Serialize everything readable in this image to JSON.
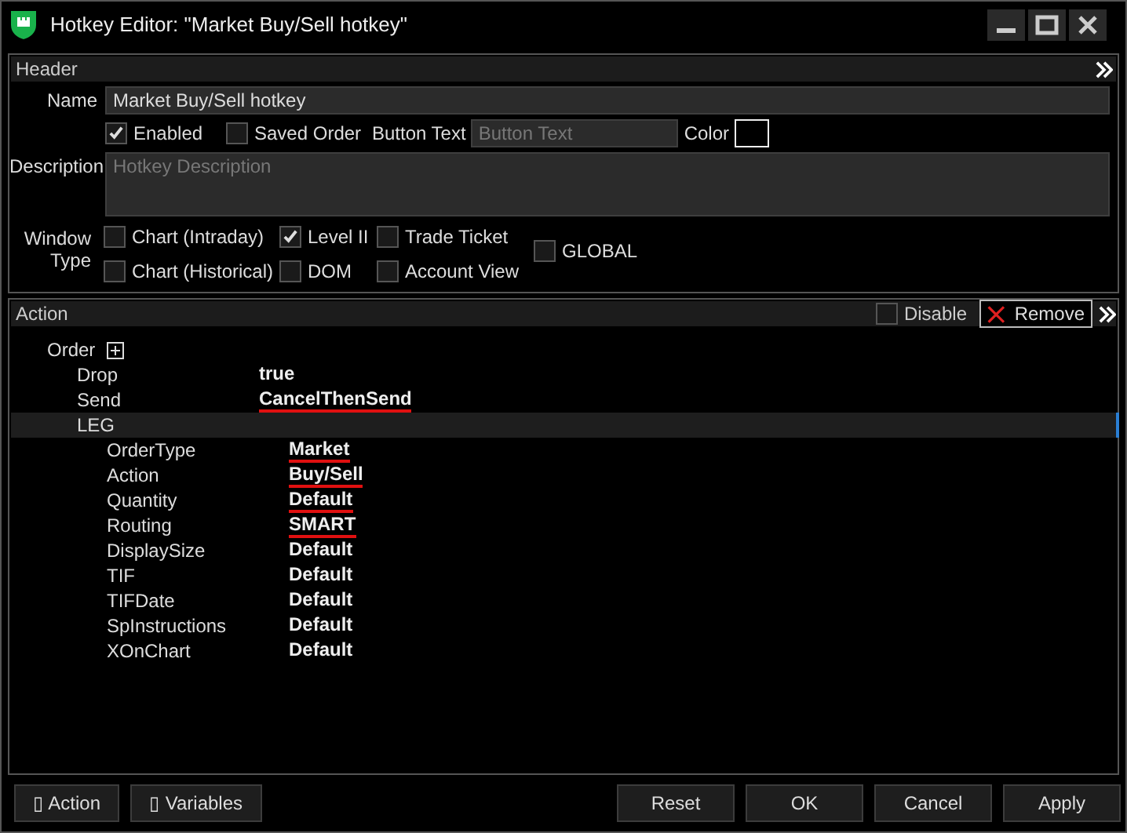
{
  "window": {
    "title": "Hotkey Editor: \"Market Buy/Sell hotkey\""
  },
  "header": {
    "title": "Header",
    "name": {
      "label": "Name",
      "value": "Market Buy/Sell hotkey"
    },
    "enabled": {
      "label": "Enabled",
      "checked": true
    },
    "saved_order": {
      "label": "Saved Order",
      "checked": false
    },
    "button_text": {
      "label": "Button Text",
      "placeholder": "Button Text"
    },
    "color": {
      "label": "Color",
      "color": "#000000"
    },
    "description": {
      "label": "Description",
      "placeholder": "Hotkey Description"
    },
    "window_type": {
      "label": "Window Type",
      "items": [
        {
          "label": "Chart (Intraday)",
          "checked": false
        },
        {
          "label": "Chart (Historical)",
          "checked": false
        },
        {
          "label": "Level II",
          "checked": true
        },
        {
          "label": "DOM",
          "checked": false
        },
        {
          "label": "Trade Ticket",
          "checked": false
        },
        {
          "label": "Account View",
          "checked": false
        }
      ],
      "global": {
        "label": "GLOBAL",
        "checked": false
      }
    }
  },
  "action": {
    "title": "Action",
    "disable": {
      "label": "Disable",
      "checked": false
    },
    "remove": "Remove",
    "tree": [
      {
        "label": "Order",
        "toggle": true,
        "selected": false,
        "children": [
          {
            "label": "Drop",
            "value": "true",
            "underlined": false,
            "selected": false
          },
          {
            "label": "Send",
            "value": "CancelThenSend",
            "underlined": true,
            "selected": false
          },
          {
            "label": "LEG",
            "selected": true,
            "children": [
              {
                "label": "OrderType",
                "value": "Market",
                "underlined": true,
                "selected": false
              },
              {
                "label": "Action",
                "value": "Buy/Sell",
                "underlined": true,
                "selected": false
              },
              {
                "label": "Quantity",
                "value": "Default",
                "underlined": true,
                "selected": false
              },
              {
                "label": "Routing",
                "value": "SMART",
                "underlined": true,
                "selected": false
              },
              {
                "label": "DisplaySize",
                "value": "Default",
                "underlined": false,
                "selected": false
              },
              {
                "label": "TIF",
                "value": "Default",
                "underlined": false,
                "selected": false
              },
              {
                "label": "TIFDate",
                "value": "Default",
                "underlined": false,
                "selected": false
              },
              {
                "label": "SpInstructions",
                "value": "Default",
                "underlined": false,
                "selected": false
              },
              {
                "label": "XOnChart",
                "value": "Default",
                "underlined": false,
                "selected": false
              }
            ]
          }
        ]
      }
    ]
  },
  "footer": {
    "left_buttons": [
      {
        "glyph": "▯",
        "label": "Action"
      },
      {
        "glyph": "▯",
        "label": "Variables"
      }
    ],
    "right_buttons": [
      "Reset",
      "OK",
      "Cancel",
      "Apply"
    ]
  }
}
